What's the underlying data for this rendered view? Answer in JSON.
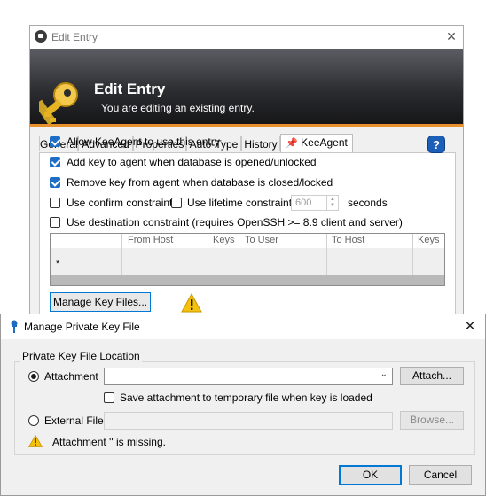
{
  "edit_entry": {
    "window_title": "Edit Entry",
    "close_glyph": "✕",
    "banner_title": "Edit Entry",
    "banner_subtitle": "You are editing an existing entry.",
    "tabs": [
      {
        "label": "General"
      },
      {
        "label": "Advanced"
      },
      {
        "label": "Properties"
      },
      {
        "label": "Auto-Type"
      },
      {
        "label": "History"
      },
      {
        "label": "KeeAgent",
        "active": true
      }
    ],
    "options": {
      "allow": {
        "label": "Allow KeeAgent to use this entry",
        "checked": true
      },
      "add_key": {
        "label": "Add key to agent when database is opened/unlocked",
        "checked": true
      },
      "remove_key": {
        "label": "Remove key from agent when database is closed/locked",
        "checked": true
      },
      "confirm": {
        "label": "Use confirm constraint",
        "checked": false
      },
      "lifetime": {
        "label": "Use lifetime constraint",
        "checked": false
      },
      "lifetime_value": "600",
      "lifetime_unit": "seconds",
      "destination": {
        "label": "Use destination constraint (requires OpenSSH >= 8.9 client and server)",
        "checked": false
      }
    },
    "help_label": "?",
    "constraint_table": {
      "columns": [
        "",
        "From Host",
        "Keys",
        "To User",
        "To Host",
        "Keys"
      ],
      "new_row_marker": "*"
    },
    "manage_button": "Manage Key Files...",
    "warning_icon": "warning-icon"
  },
  "dialog": {
    "title": "Manage Private Key File",
    "close_glyph": "✕",
    "group_label": "Private Key File Location",
    "attachment_label": "Attachment",
    "attachment_selected": true,
    "attachment_value": "",
    "attach_button": "Attach...",
    "save_temp_label": "Save attachment to temporary file when key is loaded",
    "save_temp_checked": false,
    "external_label": "External File",
    "external_selected": false,
    "browse_button": "Browse...",
    "warning_text": "Attachment '' is missing.",
    "ok_button": "OK",
    "cancel_button": "Cancel"
  },
  "colors": {
    "accent": "#e8912c",
    "checkbox": "#1e6ec8",
    "focus": "#0078d4"
  }
}
